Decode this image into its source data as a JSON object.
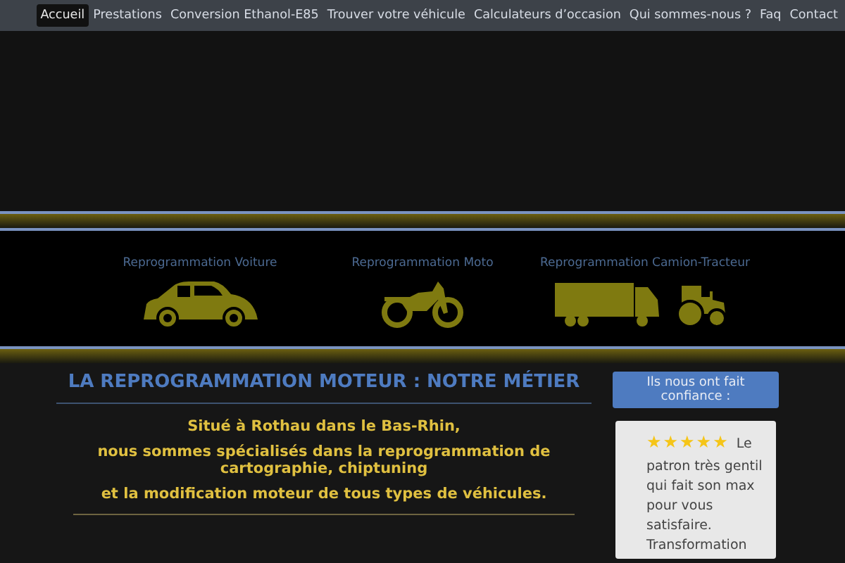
{
  "nav": [
    {
      "label": "Accueil",
      "selected": true
    },
    {
      "label": "Prestations",
      "selected": false
    },
    {
      "label": "Conversion Ethanol-E85",
      "selected": false
    },
    {
      "label": "Trouver votre véhicule",
      "selected": false
    },
    {
      "label": "Calculateurs d’occasion",
      "selected": false
    },
    {
      "label": "Qui sommes-nous ?",
      "selected": false
    },
    {
      "label": "Faq",
      "selected": false
    },
    {
      "label": "Contact",
      "selected": false
    }
  ],
  "services": [
    {
      "label": "Reprogrammation Voiture",
      "kind": "car"
    },
    {
      "label": "Reprogrammation Moto",
      "kind": "moto"
    },
    {
      "label": "Reprogrammation Camion-Tracteur",
      "kind": "truck"
    }
  ],
  "main": {
    "title": "LA REPROGRAMMATION MOTEUR : NOTRE MÉTIER",
    "lines": [
      "Situé à Rothau dans le Bas-Rhin,",
      "nous sommes spécialisés dans la reprogrammation de cartographie, chiptuning",
      "et la modification moteur de tous types de véhicules."
    ]
  },
  "aside": {
    "title": "Ils nous ont fait confiance :",
    "review": {
      "stars": 5,
      "lines": [
        "Le",
        "patron très gentil qui fait son max pour vous satisfaire. Transformation"
      ]
    }
  }
}
